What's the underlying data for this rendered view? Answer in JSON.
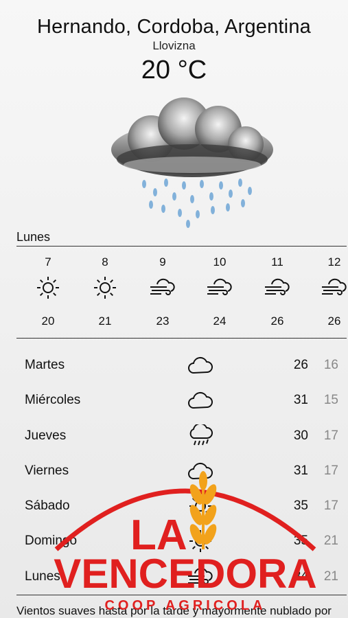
{
  "header": {
    "location": "Hernando, Cordoba, Argentina",
    "condition": "Llovizna",
    "temperature": "20 °C",
    "hero_icon": "rain-cloud-icon"
  },
  "today": {
    "label": "Lunes",
    "hourly": [
      {
        "hour": "7",
        "icon": "sun-icon",
        "temp": "20"
      },
      {
        "hour": "8",
        "icon": "sun-icon",
        "temp": "21"
      },
      {
        "hour": "9",
        "icon": "wind-cloud-icon",
        "temp": "23"
      },
      {
        "hour": "10",
        "icon": "wind-cloud-icon",
        "temp": "24"
      },
      {
        "hour": "11",
        "icon": "wind-cloud-icon",
        "temp": "26"
      },
      {
        "hour": "12",
        "icon": "wind-cloud-icon",
        "temp": "26"
      }
    ]
  },
  "forecast": [
    {
      "day": "Martes",
      "icon": "cloud-icon",
      "high": "26",
      "low": "16"
    },
    {
      "day": "Miércoles",
      "icon": "cloud-icon",
      "high": "31",
      "low": "15"
    },
    {
      "day": "Jueves",
      "icon": "rain-icon",
      "high": "30",
      "low": "17"
    },
    {
      "day": "Viernes",
      "icon": "cloud-icon",
      "high": "31",
      "low": "17"
    },
    {
      "day": "Sábado",
      "icon": "sun-icon",
      "high": "35",
      "low": "17"
    },
    {
      "day": "Domingo",
      "icon": "sun-icon",
      "high": "35",
      "low": "21"
    },
    {
      "day": "Lunes",
      "icon": "wind-cloud-icon",
      "high": "34",
      "low": "21"
    }
  ],
  "summary": "Vientos suaves hasta por la tarde y mayormente nublado por",
  "watermark": {
    "line1": "LA",
    "line2": "VENCEDORA",
    "line3": "COOP AGRICOLA",
    "color": "#e0201f",
    "accent": "#f2a21b"
  }
}
